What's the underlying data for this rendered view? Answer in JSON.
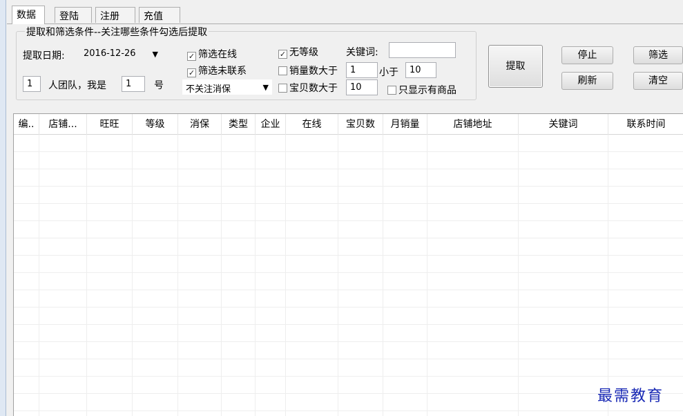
{
  "tabs": [
    "数据",
    "登陆",
    "注册",
    "充值"
  ],
  "filters": {
    "group_title": "提取和筛选条件--关注哪些条件勾选后提取",
    "date_label": "提取日期:",
    "date_value": "2016-12-26",
    "team_count": "1",
    "team_label": "人团队，我是",
    "my_number": "1",
    "number_suffix": "号",
    "cb_online": "筛选在线",
    "cb_uncontacted": "筛选未联系",
    "consumer_select": "不关注消保",
    "cb_no_level": "无等级",
    "cb_sales_gt": "销量数大于",
    "sales_gt_value": "1",
    "lt_label": "小于",
    "lt_value": "10",
    "cb_items_gt": "宝贝数大于",
    "items_gt_value": "10",
    "keyword_label": "关键词:",
    "keyword_value": "",
    "cb_only_items": "只显示有商品"
  },
  "buttons": {
    "extract": "提取",
    "stop": "停止",
    "refresh": "刷新",
    "filter": "筛选",
    "clear": "清空"
  },
  "table": {
    "columns": [
      "编..",
      "店铺...",
      "旺旺",
      "等级",
      "消保",
      "类型",
      "企业",
      "在线",
      "宝贝数",
      "月销量",
      "店铺地址",
      "关键词",
      "联系时间"
    ]
  },
  "watermark": "最需教育"
}
